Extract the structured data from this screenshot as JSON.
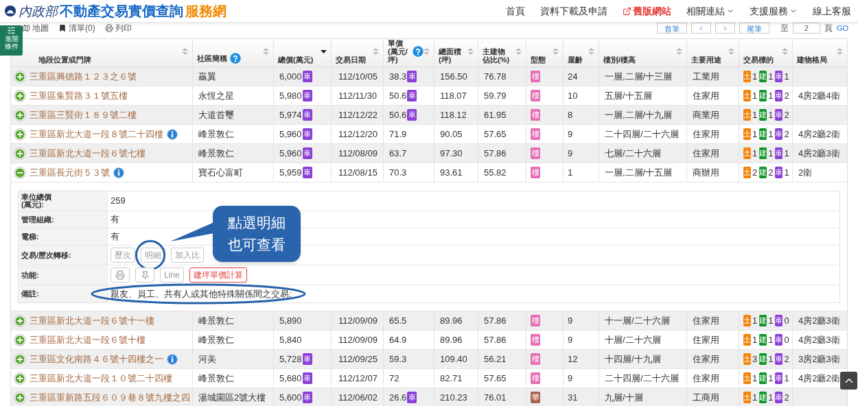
{
  "header": {
    "logo_text": "內政部",
    "title": "不動產交易實價查詢",
    "title_accent": "服務網",
    "nav": [
      {
        "label": "首頁",
        "kind": "link"
      },
      {
        "label": "資料下載及申請",
        "kind": "link"
      },
      {
        "label": "舊版網站",
        "kind": "external"
      },
      {
        "label": "相關連結",
        "kind": "dropdown"
      },
      {
        "label": "支援服務",
        "kind": "dropdown"
      },
      {
        "label": "線上客服",
        "kind": "link"
      }
    ]
  },
  "toolbar": {
    "items": [
      {
        "label": "地圖",
        "kind": "map"
      },
      {
        "label": "清單(0)",
        "kind": "list"
      },
      {
        "label": "列印",
        "kind": "print"
      }
    ],
    "pager": {
      "first": "首筆",
      "last": "尾筆",
      "goto_label": "至",
      "page": "2",
      "page_unit": "頁",
      "go": "GO"
    }
  },
  "side_tab": [
    "進階",
    "條件"
  ],
  "table": {
    "columns": [
      {
        "lines": [
          "地段位置或門牌"
        ],
        "help": false,
        "sorted": false
      },
      {
        "lines": [
          "社區簡稱"
        ],
        "help": true,
        "sorted": false
      },
      {
        "lines": [
          "總價(萬元)"
        ],
        "help": false,
        "sorted": true
      },
      {
        "lines": [
          "交易日期"
        ],
        "help": false,
        "sorted": false
      },
      {
        "lines": [
          "單價",
          "(萬元/坪)"
        ],
        "help": true,
        "sorted": false
      },
      {
        "lines": [
          "總面積",
          "(坪)"
        ],
        "help": false,
        "sorted": false
      },
      {
        "lines": [
          "主建物",
          "佔比(%)"
        ],
        "help": false,
        "sorted": false
      },
      {
        "lines": [
          "型態"
        ],
        "help": false,
        "sorted": false
      },
      {
        "lines": [
          "屋齡"
        ],
        "help": false,
        "sorted": false
      },
      {
        "lines": [
          "樓別/樓高"
        ],
        "help": false,
        "sorted": false
      },
      {
        "lines": [
          "主要用途"
        ],
        "help": false,
        "sorted": false
      },
      {
        "lines": [
          "交易標的"
        ],
        "help": false,
        "sorted": false
      },
      {
        "lines": [
          "建物格局"
        ],
        "help": false,
        "sorted": false
      }
    ],
    "rows": [
      {
        "expanded": false,
        "address": "三重區興德路１２３之６號",
        "info": false,
        "community": "贏翼",
        "total": "6,000",
        "total_badge": "車",
        "date": "112/10/05",
        "unit": "38.3",
        "unit_badge": "車",
        "area": "156.50",
        "ratio": "76.78",
        "type": {
          "label": "樓",
          "color": "#e46db3"
        },
        "age": "24",
        "floors": "一層,二層/十三層",
        "use": "工業用",
        "targets": [
          {
            "label": "土",
            "count": "1",
            "color": "#f5820a"
          },
          {
            "label": "建",
            "count": "1",
            "color": "#10962a"
          },
          {
            "label": "車",
            "count": "1",
            "color": "#8b3fd6"
          }
        ]
      },
      {
        "expanded": false,
        "address": "三重區集賢路３１號五樓",
        "info": false,
        "community": "永恆之星",
        "total": "5,980",
        "total_badge": "車",
        "date": "112/11/30",
        "unit": "50.6",
        "unit_badge": "車",
        "area": "118.07",
        "ratio": "59.79",
        "type": {
          "label": "樓",
          "color": "#e46db3"
        },
        "age": "10",
        "floors": "五層/十五層",
        "use": "住家用",
        "targets": [
          {
            "label": "土",
            "count": "1",
            "color": "#f5820a"
          },
          {
            "label": "建",
            "count": "1",
            "color": "#10962a"
          },
          {
            "label": "車",
            "count": "2",
            "color": "#8b3fd6"
          }
        ],
        "layout": "4房2廳4衛"
      },
      {
        "expanded": false,
        "address": "三重區三賢街１８９號二樓",
        "info": false,
        "community": "大道首璽",
        "total": "5,974",
        "total_badge": "車",
        "date": "112/12/22",
        "unit": "50.6",
        "unit_badge": "車",
        "area": "118.12",
        "ratio": "61.95",
        "type": {
          "label": "樓",
          "color": "#e46db3"
        },
        "age": "8",
        "floors": "一層,二層/十九層",
        "use": "商業用",
        "targets": [
          {
            "label": "土",
            "count": "1",
            "color": "#f5820a"
          },
          {
            "label": "建",
            "count": "1",
            "color": "#10962a"
          },
          {
            "label": "車",
            "count": "2",
            "color": "#8b3fd6"
          }
        ]
      },
      {
        "expanded": false,
        "address": "三重區新北大道一段８號二十四樓",
        "info": true,
        "community": "峰景敦仁",
        "total": "5,960",
        "total_badge": "車",
        "date": "112/12/20",
        "unit": "71.9",
        "area": "90.05",
        "ratio": "57.65",
        "type": {
          "label": "樓",
          "color": "#e46db3"
        },
        "age": "9",
        "floors": "二十四層/二十六層",
        "use": "住家用",
        "targets": [
          {
            "label": "土",
            "count": "1",
            "color": "#f5820a"
          },
          {
            "label": "建",
            "count": "1",
            "color": "#10962a"
          },
          {
            "label": "車",
            "count": "2",
            "color": "#8b3fd6"
          }
        ],
        "layout": "4房2廳2衛"
      },
      {
        "expanded": false,
        "address": "三重區新北大道一段６號七樓",
        "info": false,
        "community": "峰景敦仁",
        "total": "5,960",
        "total_badge": "車",
        "date": "112/08/09",
        "unit": "63.7",
        "area": "97.30",
        "ratio": "57.86",
        "type": {
          "label": "樓",
          "color": "#e46db3"
        },
        "age": "9",
        "floors": "七層/二十六層",
        "use": "住家用",
        "targets": [
          {
            "label": "土",
            "count": "1",
            "color": "#f5820a"
          },
          {
            "label": "建",
            "count": "1",
            "color": "#10962a"
          },
          {
            "label": "車",
            "count": "1",
            "color": "#8b3fd6"
          }
        ],
        "layout": "4房2廳3衛"
      },
      {
        "expanded": true,
        "address": "三重區長元街５３號",
        "info": true,
        "community": "寶石心富町",
        "total": "5,959",
        "total_badge": "車",
        "date": "112/08/15",
        "unit": "70.3",
        "area": "93.61",
        "ratio": "55.82",
        "type": {
          "label": "樓",
          "color": "#e46db3"
        },
        "age": "1",
        "floors": "一層,二層/十五層",
        "use": "商辦用",
        "targets": [
          {
            "label": "土",
            "count": "2",
            "color": "#f5820a"
          },
          {
            "label": "建",
            "count": "2",
            "color": "#10962a"
          },
          {
            "label": "車",
            "count": "1",
            "color": "#8b3fd6"
          }
        ],
        "layout": "2衛",
        "detail": {
          "fields": [
            {
              "kind": "text",
              "label": [
                "車位總價",
                "(萬元):"
              ],
              "value": "259",
              "highlighted": false
            },
            {
              "kind": "text",
              "label": [
                "管理組織:"
              ],
              "value": "有",
              "highlighted": false
            },
            {
              "kind": "text",
              "label": [
                "電梯:"
              ],
              "value": "有",
              "highlighted": false
            },
            {
              "kind": "buttons",
              "highlighted": false,
              "label": [
                "交易/歷次轉移:"
              ],
              "buttons": [
                {
                  "kind": "text",
                  "label": "歷次",
                  "highlighted": false
                },
                {
                  "kind": "text",
                  "label": "明細",
                  "highlighted": true
                },
                {
                  "kind": "text",
                  "label": "加入比",
                  "highlighted": false
                }
              ]
            },
            {
              "kind": "buttons",
              "highlighted": false,
              "label": [
                "功能:"
              ],
              "buttons": [
                {
                  "kind": "print",
                  "highlighted": false
                },
                {
                  "kind": "pin",
                  "highlighted": false
                },
                {
                  "kind": "text",
                  "label": "Line",
                  "highlighted": false
                },
                {
                  "kind": "text",
                  "label": "建坪單價計算",
                  "color": "#e0403a",
                  "highlighted": false
                }
              ]
            },
            {
              "kind": "text",
              "label": [
                "備註:"
              ],
              "value": "親友、員工、共有人或其他特殊關係間之交易;",
              "highlighted": true
            }
          ]
        }
      },
      {
        "expanded": false,
        "address": "三重區新北大道一段６號十一樓",
        "info": false,
        "community": "峰景敦仁",
        "total": "5,890",
        "date": "112/09/09",
        "unit": "65.5",
        "area": "89.96",
        "ratio": "57.86",
        "type": {
          "label": "樓",
          "color": "#e46db3"
        },
        "age": "9",
        "floors": "十一層/二十六層",
        "use": "住家用",
        "targets": [
          {
            "label": "土",
            "count": "1",
            "color": "#f5820a"
          },
          {
            "label": "建",
            "count": "1",
            "color": "#10962a"
          },
          {
            "label": "車",
            "count": "0",
            "color": "#8b3fd6"
          }
        ],
        "layout": "4房2廳3衛"
      },
      {
        "expanded": false,
        "address": "三重區新北大道一段６號十樓",
        "info": false,
        "community": "峰景敦仁",
        "total": "5,840",
        "date": "112/09/09",
        "unit": "64.9",
        "area": "89.96",
        "ratio": "57.86",
        "type": {
          "label": "樓",
          "color": "#e46db3"
        },
        "age": "9",
        "floors": "十層/二十六層",
        "use": "住家用",
        "targets": [
          {
            "label": "土",
            "count": "1",
            "color": "#f5820a"
          },
          {
            "label": "建",
            "count": "1",
            "color": "#10962a"
          },
          {
            "label": "車",
            "count": "0",
            "color": "#8b3fd6"
          }
        ],
        "layout": "4房2廳3衛"
      },
      {
        "expanded": false,
        "address": "三重區文化南路４６號十四樓之一",
        "info": true,
        "community": "河美",
        "total": "5,728",
        "total_badge": "車",
        "date": "112/09/25",
        "unit": "59.3",
        "area": "109.40",
        "ratio": "56.21",
        "type": {
          "label": "樓",
          "color": "#e46db3"
        },
        "age": "12",
        "floors": "十四層/十九層",
        "use": "住家用",
        "targets": [
          {
            "label": "土",
            "count": "3",
            "color": "#f5820a"
          },
          {
            "label": "建",
            "count": "1",
            "color": "#10962a"
          },
          {
            "label": "車",
            "count": "2",
            "color": "#8b3fd6"
          }
        ],
        "layout": "3房2廳3衛"
      },
      {
        "expanded": false,
        "address": "三重區新北大道一段１０號二十四樓",
        "info": false,
        "community": "峰景敦仁",
        "total": "5,680",
        "total_badge": "車",
        "date": "112/12/07",
        "unit": "72",
        "area": "82.71",
        "ratio": "57.65",
        "type": {
          "label": "樓",
          "color": "#e46db3"
        },
        "age": "9",
        "floors": "二十四層/二十六層",
        "use": "住家用",
        "targets": [
          {
            "label": "土",
            "count": "1",
            "color": "#f5820a"
          },
          {
            "label": "建",
            "count": "1",
            "color": "#10962a"
          },
          {
            "label": "車",
            "count": "1",
            "color": "#8b3fd6"
          }
        ],
        "layout": "4房2廳2衛"
      },
      {
        "expanded": false,
        "address": "三重區重新路五段６０９巷８號九樓之四",
        "info": false,
        "community": "湯城園區2號大樓",
        "total": "5,600",
        "total_badge": "車",
        "date": "112/06/02",
        "unit": "26.6",
        "unit_badge": "車",
        "area": "210.23",
        "ratio": "76.01",
        "type": {
          "label": "華",
          "color": "#a8644a"
        },
        "age": "31",
        "floors": "九層/十層",
        "use": "工商用",
        "targets": [
          {
            "label": "土",
            "count": "1",
            "color": "#f5820a"
          },
          {
            "label": "建",
            "count": "1",
            "color": "#10962a"
          },
          {
            "label": "車",
            "count": "2",
            "color": "#8b3fd6"
          }
        ]
      }
    ]
  },
  "callout": [
    "點選明細",
    "也可查看"
  ]
}
